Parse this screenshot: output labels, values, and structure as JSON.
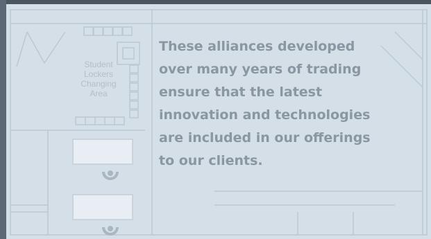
{
  "floorplan": {
    "labels": [
      "Student",
      "Lockers",
      "Changing",
      "Area"
    ]
  },
  "caption": {
    "lines": [
      "These alliances developed",
      "over many years of trading",
      "ensure that the latest",
      "innovation and technologies",
      "are included in our offerings",
      "to our clients."
    ]
  },
  "colors": {
    "panel_background": "#d5dfe7",
    "caption_text": "#8a96a2",
    "plan_lines": "#bcc8d2",
    "frame_dark": "#4a5560"
  }
}
